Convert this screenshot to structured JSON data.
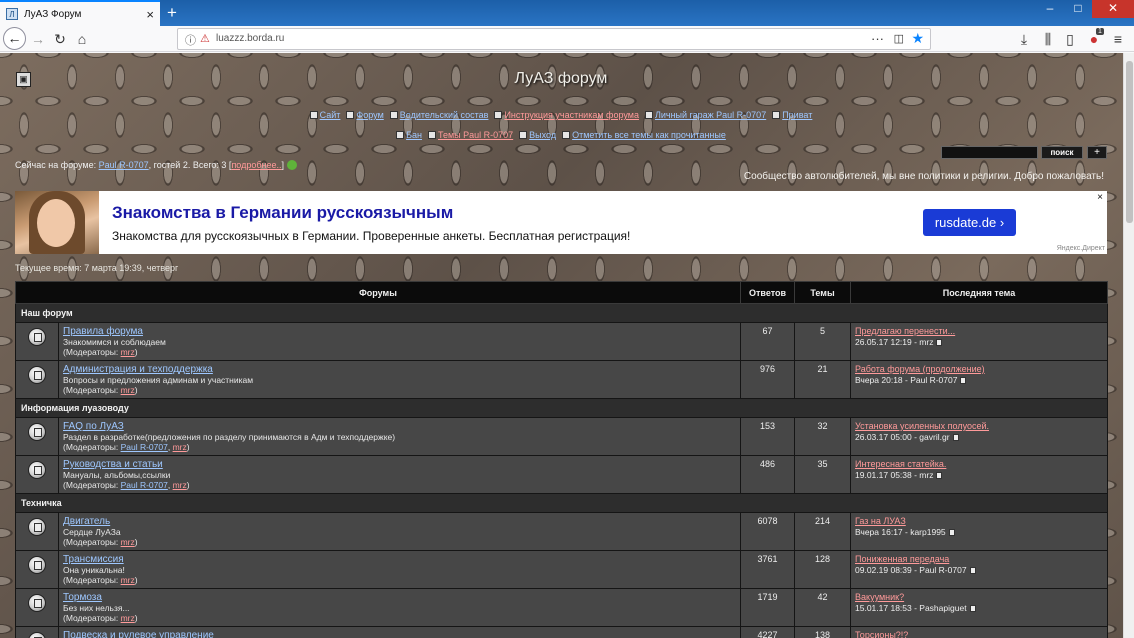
{
  "browser": {
    "tab_title": "ЛуАЗ Форум",
    "tab_favicon": "Л",
    "url": "luazzz.borda.ru",
    "addon_badge": "1"
  },
  "forum": {
    "title": "ЛуАЗ форум",
    "menu_row1": [
      {
        "label": "Сайт",
        "color": "#9ec7ff"
      },
      {
        "label": "Форум",
        "color": "#9ec7ff"
      },
      {
        "label": "Водительский состав",
        "color": "#9ec7ff"
      },
      {
        "label": "Инструкция участникам форума",
        "color": "#ff9a9a"
      },
      {
        "label": "Личный гараж Paul R-0707",
        "color": "#9ec7ff"
      },
      {
        "label": "Приват",
        "color": "#9ec7ff"
      }
    ],
    "menu_row2": [
      {
        "label": "Бан",
        "color": "#9ec7ff"
      },
      {
        "label": "Темы Paul R-0707",
        "color": "#ff9a9a"
      },
      {
        "label": "Выход",
        "color": "#9ec7ff"
      },
      {
        "label": "Отметить все темы как прочитанные",
        "color": "#9ec7ff"
      }
    ],
    "search_button": "поиск",
    "plus_button": "+",
    "online_prefix": "Сейчас на форуме: ",
    "online_user": "Paul R-0707",
    "online_suffix": ", гостей 2. Всего: 3 [",
    "online_more": "подробнее..",
    "online_close": "]",
    "slogan": "Сообщество автолюбителей, мы вне политики и религии. Добро пожаловать!",
    "current_time": "Текущее время: 7 марта 19:39, четверг"
  },
  "ad": {
    "title": "Знакомства в Германии русскоязычным",
    "text": "Знакомства для русскоязычных в Германии. Проверенные анкеты. Бесплатная регистрация!",
    "button": "rusdate.de ›",
    "close": "×",
    "source": "Яндекс.Директ"
  },
  "table": {
    "headers": {
      "forums": "Форумы",
      "replies": "Ответов",
      "topics": "Темы",
      "last": "Последняя тема"
    },
    "sections": [
      {
        "category": "Наш форум",
        "rows": [
          {
            "name": "Правила форума",
            "desc": "Знакомимся и соблюдаем",
            "mods_prefix": "(Модераторы: ",
            "mods": [
              {
                "n": "mrz",
                "c": "pink"
              }
            ],
            "replies": "67",
            "topics": "5",
            "last_title": "Предлагаю перенести...",
            "last_meta": "26.05.17 12:19 - mrz"
          },
          {
            "name": "Администрация и техподдержка",
            "desc": "Вопросы и предложения админам и участникам",
            "mods_prefix": "(Модераторы: ",
            "mods": [
              {
                "n": "mrz",
                "c": "pink"
              }
            ],
            "replies": "976",
            "topics": "21",
            "last_title": "Работа форума (продолжение)",
            "last_meta": "Вчера 20:18 - Paul R-0707"
          }
        ]
      },
      {
        "category": "Информация луазоводу",
        "rows": [
          {
            "name": "FAQ по ЛуАЗ",
            "desc": "Раздел в разработке(предложения по разделу принимаются в Адм и техподдержке)",
            "mods_prefix": "(Модераторы: ",
            "mods": [
              {
                "n": "Paul R-0707",
                "c": "blue"
              },
              {
                "n": "mrz",
                "c": "pink"
              }
            ],
            "replies": "153",
            "topics": "32",
            "last_title": "Установка усиленных полуосей.",
            "last_meta": "26.03.17 05:00 - gavril.gr"
          },
          {
            "name": "Руководства и статьи",
            "desc": "Мануалы, альбомы,ссылки",
            "mods_prefix": "(Модераторы: ",
            "mods": [
              {
                "n": "Paul R-0707",
                "c": "blue"
              },
              {
                "n": "mrz",
                "c": "pink"
              }
            ],
            "replies": "486",
            "topics": "35",
            "last_title": "Интересная статейка.",
            "last_meta": "19.01.17 05:38 - mrz"
          }
        ]
      },
      {
        "category": "Техничка",
        "rows": [
          {
            "name": "Двигатель",
            "desc": "Сердце ЛуАЗа",
            "mods_prefix": "(Модераторы: ",
            "mods": [
              {
                "n": "mrz",
                "c": "pink"
              }
            ],
            "replies": "6078",
            "topics": "214",
            "last_title": "Газ на ЛУАЗ",
            "last_meta": "Вчера 16:17 - karp1995"
          },
          {
            "name": "Трансмиссия",
            "desc": "Она уникальна!",
            "mods_prefix": "(Модераторы: ",
            "mods": [
              {
                "n": "mrz",
                "c": "pink"
              }
            ],
            "replies": "3761",
            "topics": "128",
            "last_title": "Пониженная передача",
            "last_meta": "09.02.19 08:39 - Paul R-0707"
          },
          {
            "name": "Тормоза",
            "desc": "Без них нельзя...",
            "mods_prefix": "(Модераторы: ",
            "mods": [
              {
                "n": "mrz",
                "c": "pink"
              }
            ],
            "replies": "1719",
            "topics": "42",
            "last_title": "Вакуумник?",
            "last_meta": "15.01.17 18:53 - Pashapiguet"
          },
          {
            "name": "Подвеска и рулевое управление",
            "desc": "",
            "mods_prefix": "",
            "mods": [],
            "replies": "4227",
            "topics": "138",
            "last_title": "Торсионы?!?",
            "last_meta": ""
          }
        ]
      }
    ]
  }
}
